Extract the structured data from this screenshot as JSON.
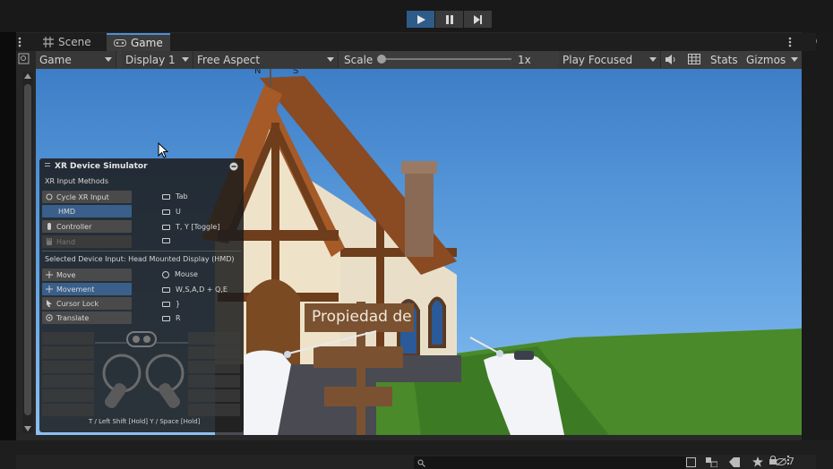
{
  "playbar": {
    "buttons": [
      "play",
      "pause",
      "step"
    ]
  },
  "tabs": [
    {
      "label": "Scene",
      "icon": "grid-icon"
    },
    {
      "label": "Game",
      "icon": "gamepad-icon"
    }
  ],
  "toolbar": {
    "view_mode": "Game",
    "display": "Display 1",
    "aspect": "Free Aspect",
    "scale_label": "Scale",
    "scale_value": "1x",
    "play_mode": "Play Focused",
    "stats": "Stats",
    "gizmos": "Gizmos"
  },
  "scene": {
    "weathervane": {
      "n": "N",
      "s": "S"
    },
    "sign_text": "Propiedad de"
  },
  "xr_panel": {
    "title": "XR Device Simulator",
    "input_methods_label": "XR Input Methods",
    "methods": [
      {
        "label": "Cycle XR Input",
        "key": "Tab",
        "state": "normal"
      },
      {
        "label": "HMD",
        "key": "U",
        "state": "selected"
      },
      {
        "label": "Controller",
        "key": "T, Y [Toggle]",
        "state": "normal"
      },
      {
        "label": "Hand",
        "key": "",
        "state": "disabled"
      }
    ],
    "selected_device_label": "Selected Device Input: Head Mounted Display (HMD)",
    "device_inputs": [
      {
        "label": "Move",
        "key": "Mouse",
        "key_icon": "mouse-icon",
        "state": "normal"
      },
      {
        "label": "Movement",
        "key": "W,S,A,D + Q,E",
        "key_icon": "keyboard-icon",
        "state": "selected"
      },
      {
        "label": "Cursor Lock",
        "key": "}",
        "key_icon": "keyboard-icon",
        "state": "normal"
      },
      {
        "label": "Translate",
        "key": "R",
        "key_icon": "keyboard-icon",
        "state": "normal"
      }
    ],
    "footer_hint": "T / Left Shift [Hold]  Y / Space [Hold]"
  },
  "statusbar": {
    "badge_count": "7"
  },
  "colors": {
    "accent": "#4a90d9",
    "selected": "#3a5f8a",
    "sky": "#66a6e4",
    "grass": "#4a8a2a"
  }
}
